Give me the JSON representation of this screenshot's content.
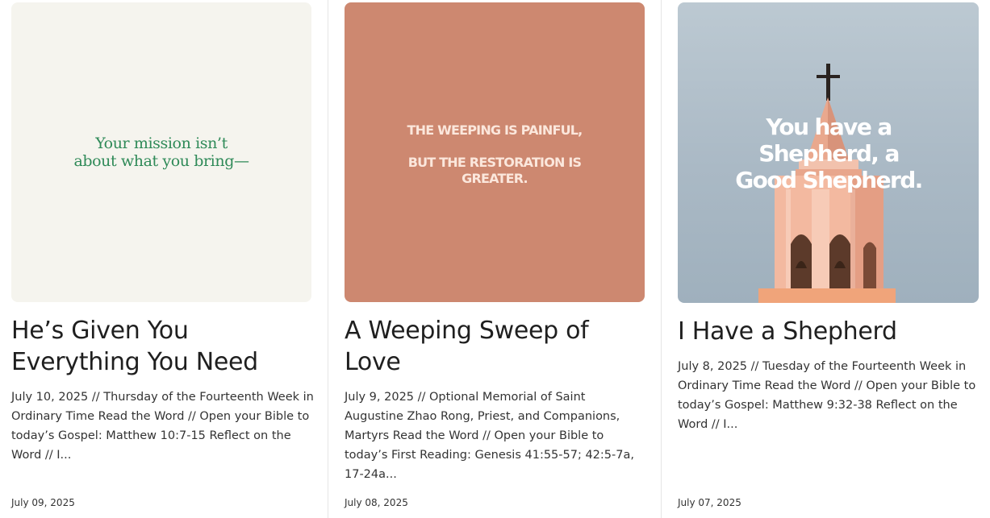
{
  "posts": [
    {
      "image_text": "Your mission isn’t about what you bring—",
      "title": "He’s Given You Everything You Need",
      "excerpt": "July 10, 2025 // Thursday of the Fourteenth Week in Ordinary Time Read the Word // Open your Bible to today’s Gospel: Matthew 10:7-15 Reflect on the Word //  I...",
      "date": "July 09, 2025"
    },
    {
      "image_text_line1": "THE WEEPING IS PAINFUL,",
      "image_text_line2": "BUT THE RESTORATION IS GREATER.",
      "title": "A Weeping Sweep of Love",
      "excerpt": "July 9, 2025 // Optional Memorial of Saint Augustine Zhao Rong, Priest, and Companions, Martyrs Read the Word // Open your Bible to today’s First Reading: Genesis 41:55-57; 42:5-7a, 17-24a...",
      "date": "July 08, 2025"
    },
    {
      "image_text": "You have a Shepherd, a Good Shepherd.",
      "title": "I Have a Shepherd",
      "excerpt": "July 8, 2025 // Tuesday of the Fourteenth Week in Ordinary Time Read the Word // Open your Bible to today’s Gospel: Matthew 9:32-38 Reflect on the Word //  I...",
      "date": "July 07, 2025"
    }
  ]
}
